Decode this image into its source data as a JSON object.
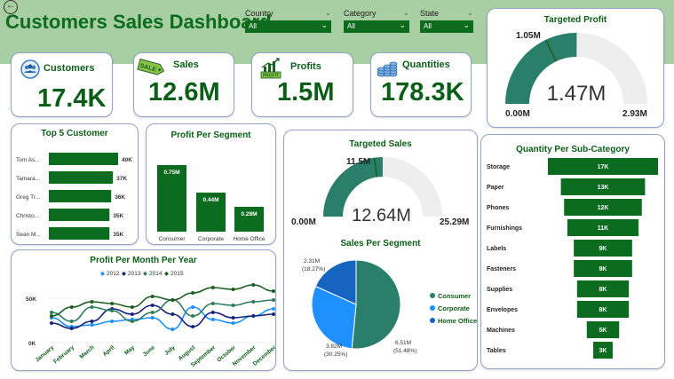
{
  "header": {
    "title": "Customers Sales Dashboard",
    "back_icon": "←"
  },
  "filters": [
    {
      "label": "Country",
      "value": "All"
    },
    {
      "label": "Category",
      "value": "All"
    },
    {
      "label": "State",
      "value": "All"
    }
  ],
  "kpis": {
    "customers": {
      "label": "Customers",
      "value": "17.4K",
      "icon": "customers-icon"
    },
    "sales": {
      "label": "Sales",
      "value": "12.6M",
      "icon": "sale-tag-icon"
    },
    "profits": {
      "label": "Profits",
      "value": "1.5M",
      "icon": "profit-chart-icon"
    },
    "quantities": {
      "label": "Quantities",
      "value": "178.3K",
      "icon": "coin-stack-icon"
    }
  },
  "icon_badges": {
    "sales_tag": "SALE",
    "profit_tag": "PROFIT"
  },
  "colors": {
    "brand_green": "#0b6b1e",
    "header_green": "#a8cfa3",
    "gauge_fill": "#2a7f6a",
    "gauge_empty": "#eeeeee",
    "series_2012": "#1e90ff",
    "series_2013": "#1a237e",
    "series_2014": "#2e7d5b",
    "series_2015": "#1b5e20",
    "pie_consumer": "#2a7f6a",
    "pie_corporate": "#1e90ff",
    "pie_home_office": "#1565c0"
  },
  "targeted_profit": {
    "title": "Targeted Profit",
    "value_label": "1.47M",
    "target_label": "1.05M",
    "min_label": "0.00M",
    "max_label": "2.93M"
  },
  "targeted_sales": {
    "title": "Targeted Sales",
    "value_label": "12.64M",
    "target_label": "11.5M",
    "min_label": "0.00M",
    "max_label": "25.29M"
  },
  "chart_data": [
    {
      "type": "bar",
      "title": "Top 5 Customer",
      "orientation": "horizontal",
      "categories": [
        "Tom As...",
        "Tamara...",
        "Greg Tr...",
        "Christo...",
        "Sean M..."
      ],
      "values": [
        40,
        37,
        36,
        35,
        35
      ],
      "value_labels": [
        "40K",
        "37K",
        "36K",
        "35K",
        "35K"
      ]
    },
    {
      "type": "bar",
      "title": "Profit Per Segment",
      "categories": [
        "Consumer",
        "Corporate",
        "Home Office"
      ],
      "values": [
        0.75,
        0.44,
        0.28
      ],
      "value_labels": [
        "0.75M",
        "0.44M",
        "0.28M"
      ]
    },
    {
      "type": "gauge",
      "title": "Targeted Profit",
      "value": 1.47,
      "target": 1.05,
      "min": 0,
      "max": 2.93
    },
    {
      "type": "gauge",
      "title": "Targeted Sales",
      "value": 12.64,
      "target": 11.5,
      "min": 0,
      "max": 25.29
    },
    {
      "type": "pie",
      "title": "Sales Per Segment",
      "categories": [
        "Consumer",
        "Corporate",
        "Home Office"
      ],
      "values": [
        6.51,
        3.82,
        2.31
      ],
      "percent": [
        51.48,
        30.25,
        18.27
      ],
      "slice_labels": [
        {
          "value": "6.51M",
          "pct": "(51.48%)"
        },
        {
          "value": "3.82M",
          "pct": "(30.25%)"
        },
        {
          "value": "2.31M",
          "pct": "(18.27%)"
        }
      ],
      "legend": "right"
    },
    {
      "type": "bar",
      "title": "Quantity Per Sub-Category",
      "subtype": "funnel",
      "categories": [
        "Storage",
        "Paper",
        "Phones",
        "Furnishings",
        "Labels",
        "Fasteners",
        "Supplies",
        "Envelopes",
        "Machines",
        "Tables"
      ],
      "values": [
        17,
        13,
        12,
        11,
        9,
        9,
        8,
        8,
        5,
        3
      ],
      "value_labels": [
        "17K",
        "13K",
        "12K",
        "11K",
        "9K",
        "9K",
        "8K",
        "8K",
        "5K",
        "3K"
      ]
    },
    {
      "type": "line",
      "title": "Profit Per Month Per Year",
      "categories": [
        "January",
        "February",
        "March",
        "April",
        "May",
        "June",
        "July",
        "August",
        "September",
        "October",
        "November",
        "December"
      ],
      "y_ticks": [
        "0K",
        "50K"
      ],
      "ylim": [
        0,
        70
      ],
      "legend": "top",
      "series": [
        {
          "name": "2012",
          "values": [
            28,
            18,
            20,
            24,
            26,
            28,
            15,
            40,
            26,
            22,
            30,
            38
          ]
        },
        {
          "name": "2013",
          "values": [
            22,
            16,
            24,
            38,
            32,
            42,
            32,
            18,
            34,
            28,
            30,
            32
          ]
        },
        {
          "name": "2014",
          "values": [
            34,
            24,
            40,
            36,
            24,
            34,
            48,
            30,
            44,
            42,
            46,
            48
          ]
        },
        {
          "name": "2015",
          "values": [
            30,
            40,
            46,
            44,
            40,
            52,
            48,
            56,
            62,
            60,
            65,
            58
          ]
        }
      ]
    }
  ]
}
